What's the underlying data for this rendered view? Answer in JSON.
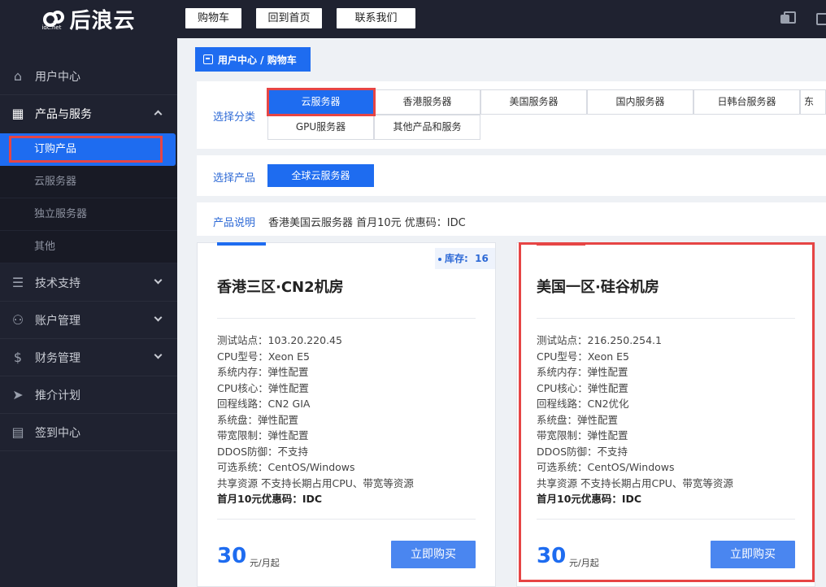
{
  "brand": {
    "logo_text": "后浪云",
    "logo_sub": "idc.net"
  },
  "topnav": {
    "cart": "购物车",
    "home": "回到首页",
    "contact": "联系我们"
  },
  "sidebar": {
    "user_center": "用户中心",
    "products": "产品与服务",
    "sub": [
      "订购产品",
      "云服务器",
      "独立服务器",
      "其他"
    ],
    "tech": "技术支持",
    "account": "账户管理",
    "finance": "财务管理",
    "promo": "推介计划",
    "signin": "签到中心"
  },
  "breadcrumb": "用户中心 / 购物车",
  "category": {
    "label": "选择分类",
    "items": [
      "云服务器",
      "香港服务器",
      "美国服务器",
      "国内服务器",
      "日韩台服务器",
      "东",
      "GPU服务器",
      "其他产品和服务"
    ],
    "selected": "云服务器"
  },
  "product": {
    "label": "选择产品",
    "selected": "全球云服务器"
  },
  "description": {
    "label": "产品说明",
    "text": "香港美国云服务器 首月10元 优惠码：IDC"
  },
  "cards": [
    {
      "stock_label": "库存:",
      "stock": "16",
      "title": "香港三区·CN2机房",
      "specs": [
        "测试站点：103.20.220.45",
        "CPU型号：Xeon E5",
        "系统内存：弹性配置",
        "CPU核心：弹性配置",
        "回程线路：CN2 GIA",
        "系统盘：弹性配置",
        "带宽限制：弹性配置",
        "DDOS防御：不支持",
        "可选系统：CentOS/Windows",
        "共享资源 不支持长期占用CPU、带宽等资源",
        "首月10元优惠码：IDC"
      ],
      "price": "30",
      "unit": "元/月起",
      "buy": "立即购买"
    },
    {
      "title": "美国一区·硅谷机房",
      "specs": [
        "测试站点：216.250.254.1",
        "CPU型号：Xeon E5",
        "系统内存：弹性配置",
        "CPU核心：弹性配置",
        "回程线路：CN2优化",
        "系统盘：弹性配置",
        "带宽限制：弹性配置",
        "DDOS防御：不支持",
        "可选系统：CentOS/Windows",
        "共享资源 不支持长期占用CPU、带宽等资源",
        "首月10元优惠码：IDC"
      ],
      "price": "30",
      "unit": "元/月起",
      "buy": "立即购买"
    }
  ],
  "colors": {
    "accent": "#1e6cf0",
    "highlight": "#e64545",
    "sidebar_bg": "#1f2230"
  }
}
